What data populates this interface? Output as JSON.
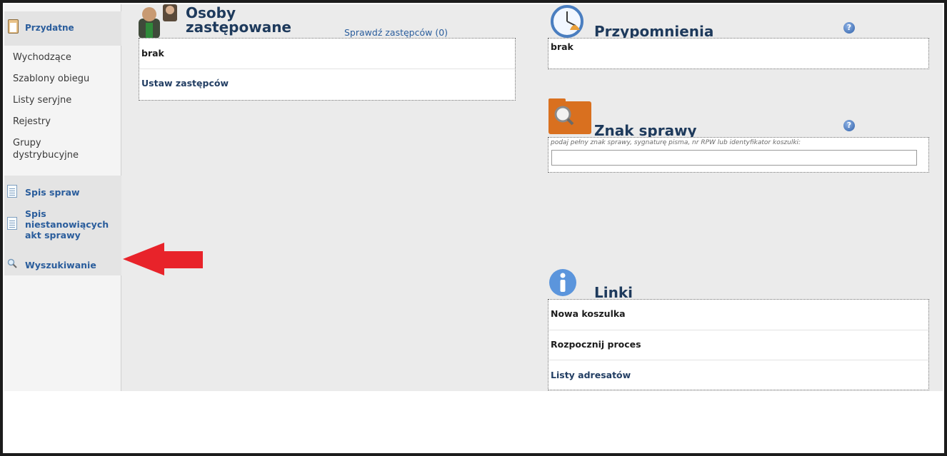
{
  "sidebar": {
    "header": "Przydatne",
    "links": [
      "Wychodzące",
      "Szablony obiegu",
      "Listy seryjne",
      "Rejestry",
      "Grupy dystrybucyjne"
    ],
    "box_items": [
      "Spis spraw",
      "Spis niestanowiących akt sprawy",
      "Wyszukiwanie"
    ]
  },
  "substitutes": {
    "title": "Osoby zastępowane",
    "check_link": "Sprawdź zastępców (0)",
    "empty": "brak",
    "set_link": "Ustaw zastępców"
  },
  "reminders": {
    "title": "Przypomnienia",
    "help": "?",
    "empty": "brak"
  },
  "case_sign": {
    "title": "Znak sprawy",
    "help": "?",
    "hint": "podaj pełny znak sprawy, sygnaturę pisma, nr RPW lub identyfikator koszulki:",
    "value": ""
  },
  "links": {
    "title": "Linki",
    "items": [
      "Nowa koszulka",
      "Rozpocznij proces",
      "Listy adresatów"
    ]
  },
  "colors": {
    "arrow": "#e8232a",
    "heading": "#1e3a5c",
    "link": "#2a5d9c"
  }
}
